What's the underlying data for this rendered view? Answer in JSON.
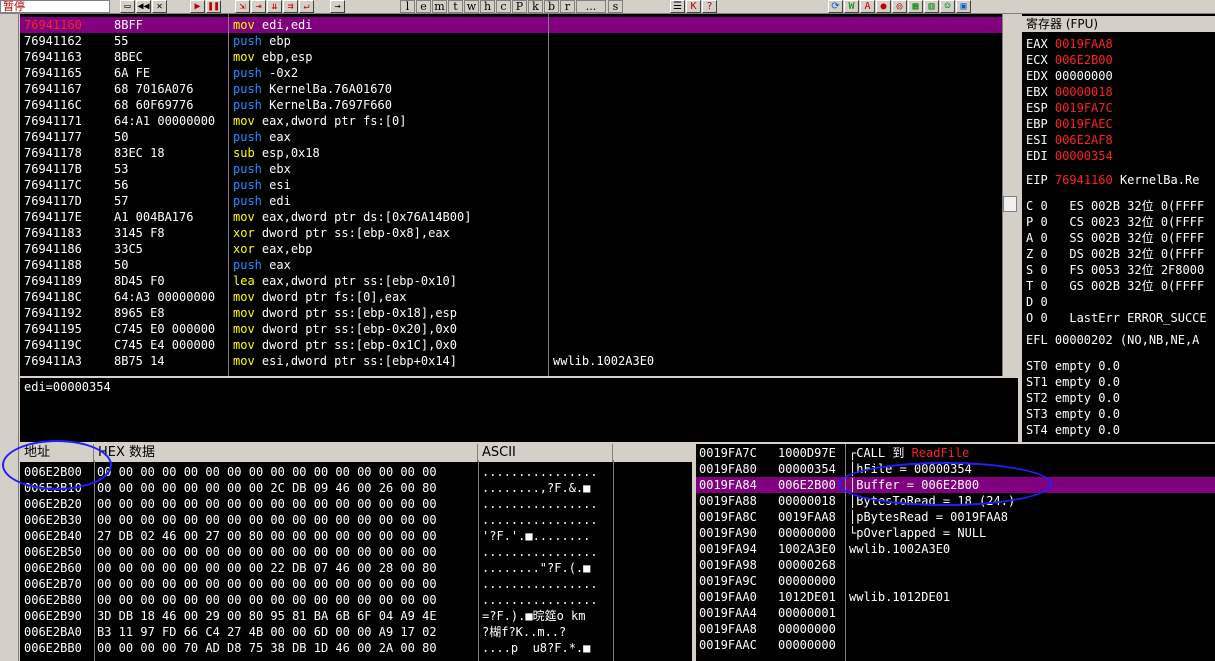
{
  "status": {
    "label": "暂停"
  },
  "toolbar": {
    "letters": [
      "l",
      "e",
      "m",
      "t",
      "w",
      "h",
      "c",
      "P",
      "k",
      "b",
      "r",
      "...",
      "s"
    ]
  },
  "disasm": {
    "rows": [
      {
        "addr": "76941160",
        "hex": "8BFF",
        "op": "mov",
        "args": "edi,edi",
        "cls": "c-mov",
        "comment": "",
        "sel": true
      },
      {
        "addr": "76941162",
        "hex": "55",
        "op": "push",
        "args": "ebp",
        "cls": "c-push",
        "comment": ""
      },
      {
        "addr": "76941163",
        "hex": "8BEC",
        "op": "mov",
        "args": "ebp,esp",
        "cls": "c-mov",
        "comment": ""
      },
      {
        "addr": "76941165",
        "hex": "6A FE",
        "op": "push",
        "args": "-0x2",
        "cls": "c-push",
        "comment": ""
      },
      {
        "addr": "76941167",
        "hex": "68 7016A076",
        "op": "push",
        "args": "KernelBa.76A01670",
        "cls": "c-push",
        "comment": ""
      },
      {
        "addr": "7694116C",
        "hex": "68 60F69776",
        "op": "push",
        "args": "KernelBa.7697F660",
        "cls": "c-push",
        "comment": ""
      },
      {
        "addr": "76941171",
        "hex": "64:A1 00000000",
        "op": "mov",
        "args": "eax,dword ptr fs:[0]",
        "cls": "c-mov",
        "comment": ""
      },
      {
        "addr": "76941177",
        "hex": "50",
        "op": "push",
        "args": "eax",
        "cls": "c-push",
        "comment": ""
      },
      {
        "addr": "76941178",
        "hex": "83EC 18",
        "op": "sub",
        "args": "esp,0x18",
        "cls": "c-sub",
        "comment": ""
      },
      {
        "addr": "7694117B",
        "hex": "53",
        "op": "push",
        "args": "ebx",
        "cls": "c-push",
        "comment": ""
      },
      {
        "addr": "7694117C",
        "hex": "56",
        "op": "push",
        "args": "esi",
        "cls": "c-push",
        "comment": ""
      },
      {
        "addr": "7694117D",
        "hex": "57",
        "op": "push",
        "args": "edi",
        "cls": "c-push",
        "comment": ""
      },
      {
        "addr": "7694117E",
        "hex": "A1 004BA176",
        "op": "mov",
        "args": "eax,dword ptr ds:[0x76A14B00]",
        "cls": "c-mov",
        "comment": ""
      },
      {
        "addr": "76941183",
        "hex": "3145 F8",
        "op": "xor",
        "args": "dword ptr ss:[ebp-0x8],eax",
        "cls": "c-xor",
        "comment": ""
      },
      {
        "addr": "76941186",
        "hex": "33C5",
        "op": "xor",
        "args": "eax,ebp",
        "cls": "c-xor",
        "comment": ""
      },
      {
        "addr": "76941188",
        "hex": "50",
        "op": "push",
        "args": "eax",
        "cls": "c-push",
        "comment": ""
      },
      {
        "addr": "76941189",
        "hex": "8D45 F0",
        "op": "lea",
        "args": "eax,dword ptr ss:[ebp-0x10]",
        "cls": "c-lea",
        "comment": ""
      },
      {
        "addr": "7694118C",
        "hex": "64:A3 00000000",
        "op": "mov",
        "args": "dword ptr fs:[0],eax",
        "cls": "c-mov",
        "comment": ""
      },
      {
        "addr": "76941192",
        "hex": "8965 E8",
        "op": "mov",
        "args": "dword ptr ss:[ebp-0x18],esp",
        "cls": "c-mov",
        "comment": ""
      },
      {
        "addr": "76941195",
        "hex": "C745 E0 000000",
        "op": "mov",
        "args": "dword ptr ss:[ebp-0x20],0x0",
        "cls": "c-mov",
        "comment": ""
      },
      {
        "addr": "7694119C",
        "hex": "C745 E4 000000",
        "op": "mov",
        "args": "dword ptr ss:[ebp-0x1C],0x0",
        "cls": "c-mov",
        "comment": ""
      },
      {
        "addr": "769411A3",
        "hex": "8B75 14",
        "op": "mov",
        "args": "esi,dword ptr ss:[ebp+0x14]",
        "cls": "c-mov",
        "comment": "wwlib.1002A3E0"
      }
    ]
  },
  "info": {
    "text": "edi=00000354"
  },
  "registers": {
    "title": "寄存器 (FPU)",
    "gprs": [
      {
        "name": "EAX",
        "value": "0019FAA8",
        "red": true
      },
      {
        "name": "ECX",
        "value": "006E2B00",
        "red": true
      },
      {
        "name": "EDX",
        "value": "00000000",
        "red": false
      },
      {
        "name": "EBX",
        "value": "00000018",
        "red": true
      },
      {
        "name": "ESP",
        "value": "0019FA7C",
        "red": true
      },
      {
        "name": "EBP",
        "value": "0019FAEC",
        "red": true
      },
      {
        "name": "ESI",
        "value": "006E2AF8",
        "red": true
      },
      {
        "name": "EDI",
        "value": "00000354",
        "red": true
      }
    ],
    "eip": {
      "name": "EIP",
      "value": "76941160",
      "extra": "KernelBa.Re"
    },
    "flags": [
      "C 0   ES 002B 32位 0(FFFF",
      "P 0   CS 0023 32位 0(FFFF",
      "A 0   SS 002B 32位 0(FFFF",
      "Z 0   DS 002B 32位 0(FFFF",
      "S 0   FS 0053 32位 2F8000",
      "T 0   GS 002B 32位 0(FFFF",
      "D 0",
      "O 0   LastErr ERROR_SUCCE"
    ],
    "efl": "EFL 00000202 (NO,NB,NE,A",
    "fpu": [
      "ST0 empty 0.0",
      "ST1 empty 0.0",
      "ST2 empty 0.0",
      "ST3 empty 0.0",
      "ST4 empty 0.0"
    ]
  },
  "dump": {
    "headers": {
      "addr": "地址",
      "hex": "HEX 数据",
      "ascii": "ASCII"
    },
    "rows": [
      {
        "addr": "006E2B00",
        "hex": "00 00 00 00 00 00 00 00 00 00 00 00 00 00 00 00",
        "ascii": "................"
      },
      {
        "addr": "006E2B10",
        "hex": "00 00 00 00 00 00 00 00 2C DB 09 46 00 26 00 80",
        "ascii": "........,?F.&.■"
      },
      {
        "addr": "006E2B20",
        "hex": "00 00 00 00 00 00 00 00 00 00 00 00 00 00 00 00",
        "ascii": "................"
      },
      {
        "addr": "006E2B30",
        "hex": "00 00 00 00 00 00 00 00 00 00 00 00 00 00 00 00",
        "ascii": "................"
      },
      {
        "addr": "006E2B40",
        "hex": "27 DB 02 46 00 27 00 80 00 00 00 00 00 00 00 00",
        "ascii": "'?F.'.■........"
      },
      {
        "addr": "006E2B50",
        "hex": "00 00 00 00 00 00 00 00 00 00 00 00 00 00 00 00",
        "ascii": "................"
      },
      {
        "addr": "006E2B60",
        "hex": "00 00 00 00 00 00 00 00 22 DB 07 46 00 28 00 80",
        "ascii": "........\"?F.(.■"
      },
      {
        "addr": "006E2B70",
        "hex": "00 00 00 00 00 00 00 00 00 00 00 00 00 00 00 00",
        "ascii": "................"
      },
      {
        "addr": "006E2B80",
        "hex": "00 00 00 00 00 00 00 00 00 00 00 00 00 00 00 00",
        "ascii": "................"
      },
      {
        "addr": "006E2B90",
        "hex": "3D DB 18 46 00 29 00 80 95 81 BA 6B 6F 04 A9 4E",
        "ascii": "=?F.).■晥筵o km"
      },
      {
        "addr": "006E2BA0",
        "hex": "B3 11 97 FD 66 C4 27 4B 00 00 6D 00 00 A9 17 02",
        "ascii": "?楜f?K..m..?"
      },
      {
        "addr": "006E2BB0",
        "hex": "00 00 00 00 70 AD D8 75 38 DB 1D 46 00 2A 00 80",
        "ascii": "....p  u8?F.*.■"
      }
    ]
  },
  "stack": {
    "rows": [
      {
        "addr": "0019FA7C",
        "val": "1000D97E",
        "cmt": "┌CALL 到 ",
        "cmt2": "ReadFile"
      },
      {
        "addr": "0019FA80",
        "val": "00000354",
        "cmt": "│hFile = 00000354"
      },
      {
        "addr": "0019FA84",
        "val": "006E2B00",
        "cmt": "│Buffer = 006E2B00",
        "sel": true
      },
      {
        "addr": "0019FA88",
        "val": "00000018",
        "cmt": "│BytesToRead = 18 (24.)"
      },
      {
        "addr": "0019FA8C",
        "val": "0019FAA8",
        "cmt": "│pBytesRead = 0019FAA8"
      },
      {
        "addr": "0019FA90",
        "val": "00000000",
        "cmt": "└pOverlapped = NULL"
      },
      {
        "addr": "0019FA94",
        "val": "1002A3E0",
        "cmt": "wwlib.1002A3E0"
      },
      {
        "addr": "0019FA98",
        "val": "00000268",
        "cmt": ""
      },
      {
        "addr": "0019FA9C",
        "val": "00000000",
        "cmt": ""
      },
      {
        "addr": "0019FAA0",
        "val": "1012DE01",
        "cmt": "wwlib.1012DE01"
      },
      {
        "addr": "0019FAA4",
        "val": "00000001",
        "cmt": ""
      },
      {
        "addr": "0019FAA8",
        "val": "00000000",
        "cmt": ""
      },
      {
        "addr": "0019FAAC",
        "val": "00000000",
        "cmt": ""
      }
    ]
  }
}
